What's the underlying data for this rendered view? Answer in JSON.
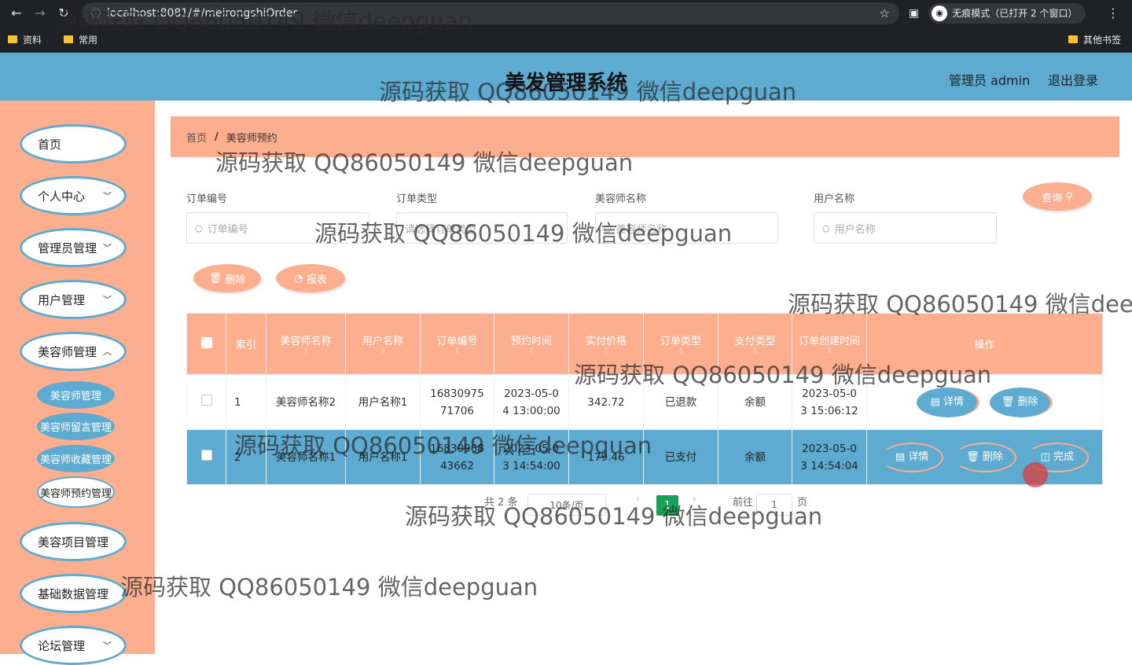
{
  "browser": {
    "url": "localhost:8081/#/meirongshiOrder",
    "incognito": "无痕模式（已打开 2 个窗口）",
    "bookmarks": [
      "资料",
      "常用"
    ],
    "bookmarks_right": "其他书签"
  },
  "header": {
    "title": "美发管理系统",
    "admin": "管理员 admin",
    "logout": "退出登录"
  },
  "sidebar": {
    "items": [
      "首页",
      "个人中心",
      "管理员管理",
      "用户管理",
      "美容师管理",
      "美容项目管理",
      "基础数据管理",
      "论坛管理"
    ],
    "sub": [
      "美容师管理",
      "美容师留言管理",
      "美容师收藏管理",
      "美容师预约管理"
    ]
  },
  "breadcrumb": {
    "home": "首页",
    "sep": "/",
    "current": "美容师预约"
  },
  "search": {
    "labels": [
      "订单编号",
      "订单类型",
      "美容师名称",
      "用户名称"
    ],
    "placeholders": [
      "订单编号",
      "请选择订单类型",
      "美容师名称",
      "用户名称"
    ],
    "query_btn": "查询"
  },
  "actions": {
    "delete": "删除",
    "report": "报表"
  },
  "table": {
    "headers": [
      "索引",
      "美容师名称",
      "用户名称",
      "订单编号",
      "预约时间",
      "实付价格",
      "订单类型",
      "支付类型",
      "订单创建时间",
      "操作"
    ],
    "rows": [
      {
        "idx": "1",
        "beauty": "美容师名称2",
        "user": "用户名称1",
        "no1": "16830975",
        "no2": "71706",
        "t1": "2023-05-0",
        "t2": "4 13:00:00",
        "price": "342.72",
        "otype": "已退款",
        "ptype": "余额",
        "c1": "2023-05-0",
        "c2": "3 15:06:12"
      },
      {
        "idx": "2",
        "beauty": "美容师名称1",
        "user": "用户名称1",
        "no1": "16830968",
        "no2": "43662",
        "t1": "2023-05-0",
        "t2": "3 14:54:00",
        "price": "179.46",
        "otype": "已支付",
        "ptype": "余额",
        "c1": "2023-05-0",
        "c2": "3 14:54:04"
      }
    ],
    "btn_detail": "详情",
    "btn_delete": "删除",
    "btn_done": "完成"
  },
  "pagination": {
    "total": "共 2 条",
    "page_size": "10条/页",
    "current": "1",
    "goto": "前往",
    "goto_val": "1",
    "page_unit": "页"
  },
  "watermark": "源码获取 QQ86050149 微信deepguan",
  "colors": {
    "blue": "#5eabd2",
    "peach": "#fdae8e",
    "green": "#18a058"
  }
}
